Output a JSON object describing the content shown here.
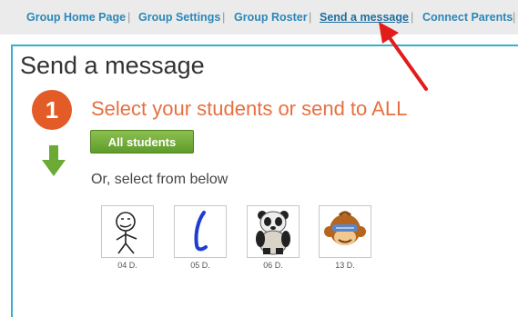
{
  "nav": {
    "links": [
      {
        "label": "Group Home Page"
      },
      {
        "label": "Group Settings"
      },
      {
        "label": "Group Roster"
      },
      {
        "label": "Send a message"
      },
      {
        "label": "Connect Parents"
      }
    ],
    "separator": "|",
    "active_index": 3
  },
  "page": {
    "title": "Send a message"
  },
  "step": {
    "number": "1",
    "heading": "Select your students or send to ALL",
    "all_button_label": "All students",
    "or_text": "Or, select from below"
  },
  "students": [
    {
      "name": "04 D.",
      "avatar_icon": "stick-figure-icon"
    },
    {
      "name": "05 D.",
      "avatar_icon": "blue-squiggle-icon"
    },
    {
      "name": "06 D.",
      "avatar_icon": "panda-icon"
    },
    {
      "name": "13 D.",
      "avatar_icon": "monkey-icon"
    }
  ],
  "colors": {
    "accent_orange": "#e35b26",
    "heading_orange": "#e86f3f",
    "button_green": "#7ab541",
    "link_blue": "#2c87b8",
    "panel_border": "#3ab0c8",
    "annotation_red": "#e21b1b"
  }
}
